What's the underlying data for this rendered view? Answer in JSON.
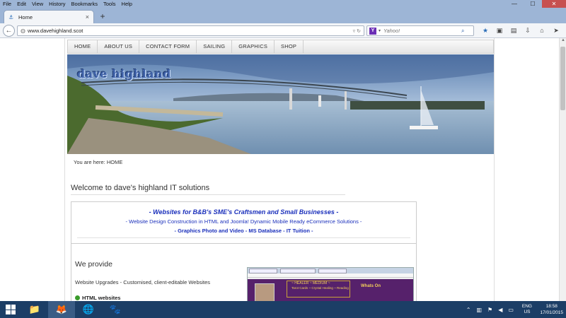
{
  "menu": [
    "File",
    "Edit",
    "View",
    "History",
    "Bookmarks",
    "Tools",
    "Help"
  ],
  "window": {
    "minimize": "—",
    "maximize": "☐",
    "close": "✕"
  },
  "tab": {
    "title": "Home",
    "close": "×",
    "new": "+"
  },
  "address": {
    "url": "www.davehighland.scot"
  },
  "search": {
    "engine": "Y",
    "placeholder": "Yahoo!"
  },
  "site": {
    "nav": [
      "HOME",
      "ABOUT US",
      "CONTACT FORM",
      "SAILING",
      "GRAPHICS",
      "SHOP"
    ],
    "brand": "dave highland",
    "breadcrumb": "You are here: HOME",
    "welcome": "Welcome to dave's highland IT solutions",
    "promo": {
      "line1": "- Websites for B&B's SME's Craftsmen and Small Businesses -",
      "line2": "- Website Design Construction in HTML and Joomla! Dynamic Mobile Ready eCommerce Solutions -",
      "line3": "- Graphics  Photo and Video - MS Database - IT Tuition -"
    },
    "provide": {
      "heading": "We provide",
      "item1": "Website Upgrades -  Customised, client-editable Websites",
      "item2": "HTML websites"
    },
    "thumb": {
      "head1": "~ HEALER ~ MEDIUM ~",
      "head2": "Tarot Cards ~ Crystal Healing ~ Reading",
      "whats_on": "Whats On"
    }
  },
  "tray": {
    "lang_top": "ENG",
    "lang_bottom": "US",
    "time": "18:58",
    "date": "17/01/2015"
  },
  "colors": {
    "promo_blue": "#1a2fbb",
    "brand_blue": "#3f62a8",
    "taskbar": "#1c3e66"
  }
}
